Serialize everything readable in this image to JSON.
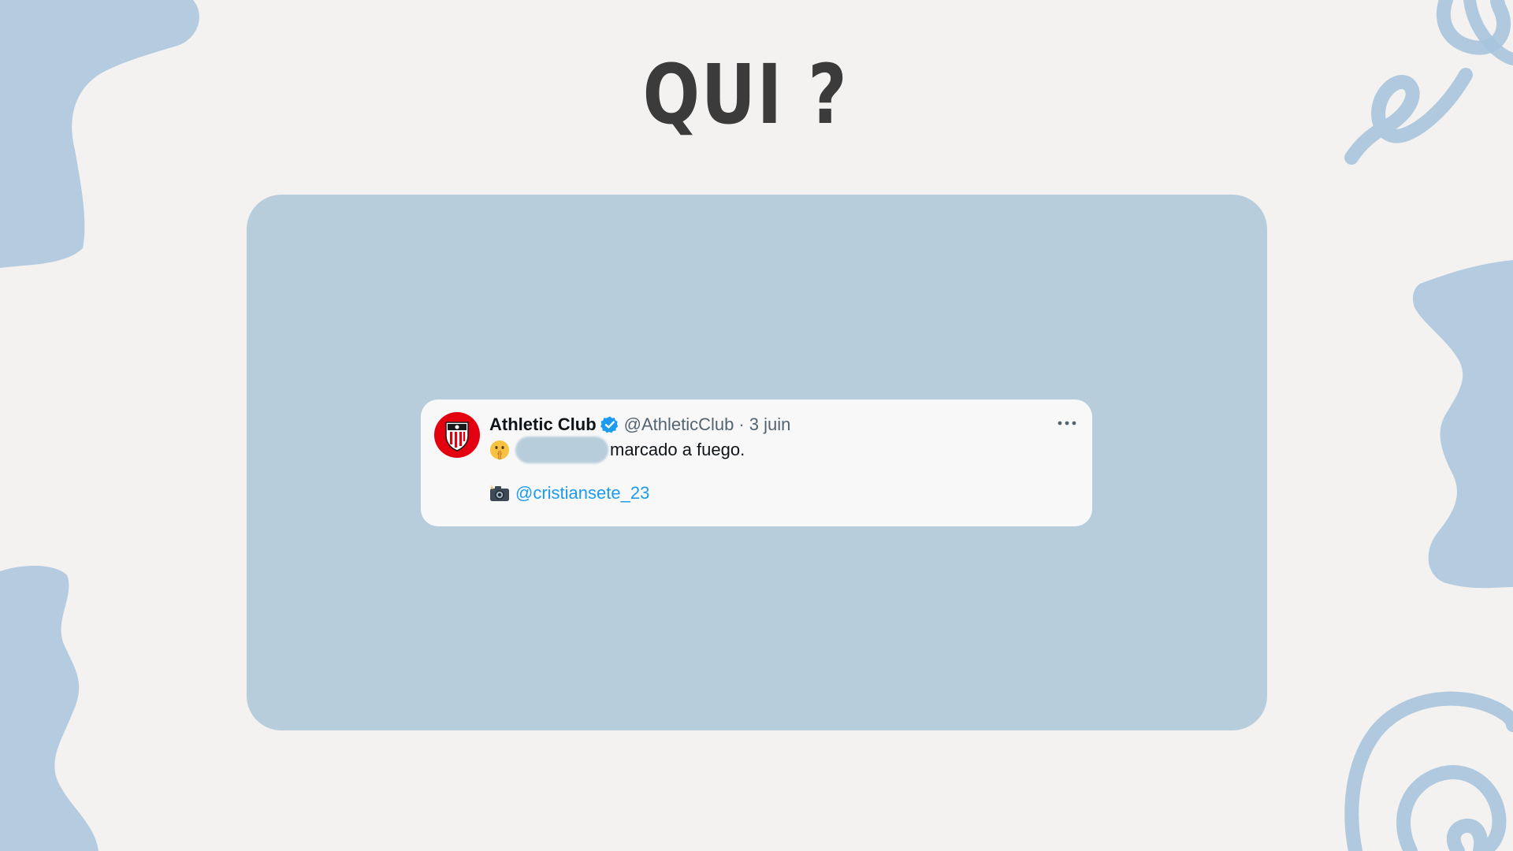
{
  "slide": {
    "title": "QUI ?"
  },
  "tweet": {
    "author_name": "Athletic Club",
    "handle": "@AthleticClub",
    "separator": "·",
    "date": "3 juin",
    "text_after_redaction": "marcado a fuego.",
    "photo_credit": "@cristiansete_23",
    "icons": {
      "avatar": "athletic-club-crest-icon",
      "verified": "verified-badge-icon",
      "more": "more-options-icon",
      "emoji": "shushing-face-emoji-icon",
      "camera": "camera-flash-emoji-icon"
    }
  },
  "colors": {
    "background": "#f3f2f0",
    "panel": "#b8cddc",
    "decor": "#a9c4dd",
    "title": "#3b3b3b",
    "tweet_card": "#f8f8f8",
    "mention": "#1d9bf0",
    "verified": "#1d9bf0"
  }
}
